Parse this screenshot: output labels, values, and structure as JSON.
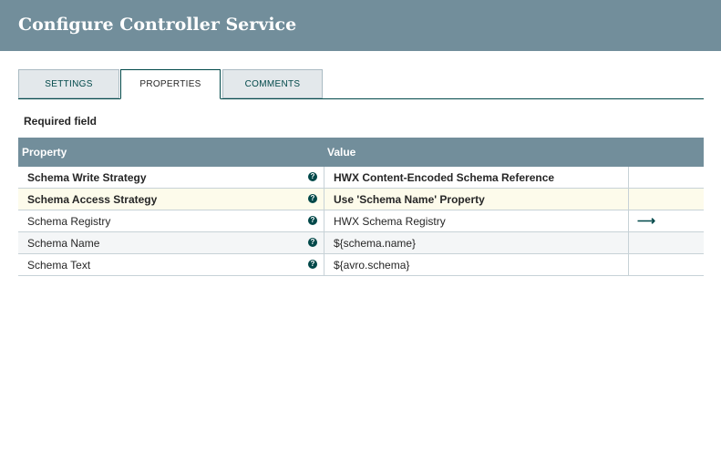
{
  "dialog": {
    "title": "Configure Controller Service"
  },
  "tabs": [
    {
      "label": "SETTINGS",
      "active": false
    },
    {
      "label": "PROPERTIES",
      "active": true
    },
    {
      "label": "COMMENTS",
      "active": false
    }
  ],
  "required_field_label": "Required field",
  "table": {
    "headers": {
      "property": "Property",
      "value": "Value"
    },
    "rows": [
      {
        "name": "Schema Write Strategy",
        "value": "HWX Content-Encoded Schema Reference",
        "required": true,
        "help_icon": "question-circle-icon"
      },
      {
        "name": "Schema Access Strategy",
        "value": "Use 'Schema Name' Property",
        "required": true,
        "help_icon": "question-circle-icon"
      },
      {
        "name": "Schema Registry",
        "value": "HWX Schema Registry",
        "required": false,
        "help_icon": "question-circle-icon",
        "action_icon": "arrow-right-icon"
      },
      {
        "name": "Schema Name",
        "value": "${schema.name}",
        "required": false,
        "help_icon": "question-circle-icon"
      },
      {
        "name": "Schema Text",
        "value": "${avro.schema}",
        "required": false,
        "help_icon": "question-circle-icon"
      }
    ]
  },
  "colors": {
    "header_bg": "#728e9b",
    "accent": "#004849",
    "selected_row": "#fdfbeb"
  }
}
